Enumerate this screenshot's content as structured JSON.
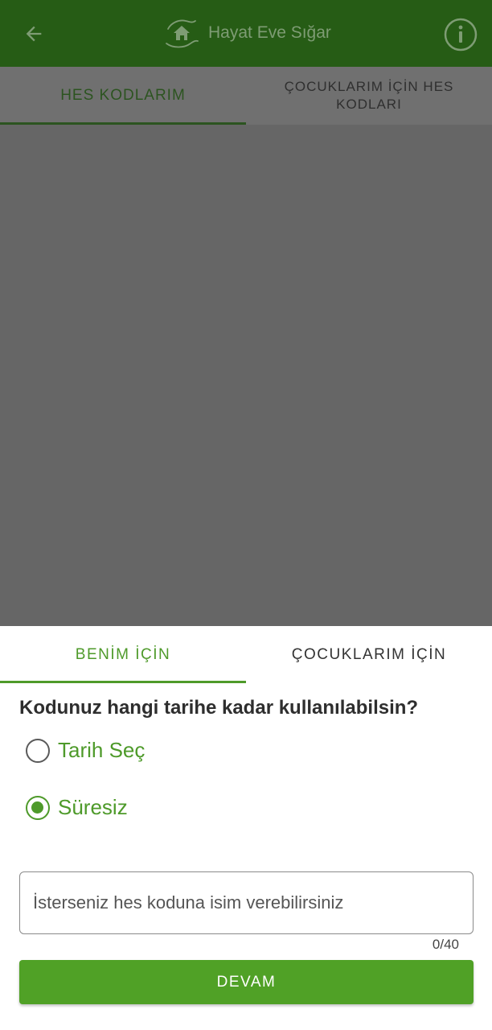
{
  "app": {
    "title": "Hayat Eve Sığar",
    "brand_color": "#265c15",
    "accent_color": "#4e9a2a",
    "icons": {
      "back": "arrow-left-icon",
      "logo": "house-in-hands-icon",
      "info": "info-circle-icon"
    }
  },
  "background_tabs": [
    {
      "label": "HES KODLARIM",
      "selected": true
    },
    {
      "label": "ÇOCUKLARIM İÇİN HES KODLARI",
      "selected": false
    }
  ],
  "sheet": {
    "tabs": [
      {
        "label": "BENİM İÇİN",
        "selected": true
      },
      {
        "label": "ÇOCUKLARIM İÇİN",
        "selected": false
      }
    ],
    "question": "Kodunuz hangi tarihe kadar kullanılabilsin?",
    "options": [
      {
        "label": "Tarih Seç",
        "checked": false
      },
      {
        "label": "Süresiz",
        "checked": true
      }
    ],
    "name_input": {
      "placeholder": "İsterseniz hes koduna isim verebilirsiniz",
      "value": ""
    },
    "counter": "0/40",
    "submit_label": "DEVAM"
  }
}
